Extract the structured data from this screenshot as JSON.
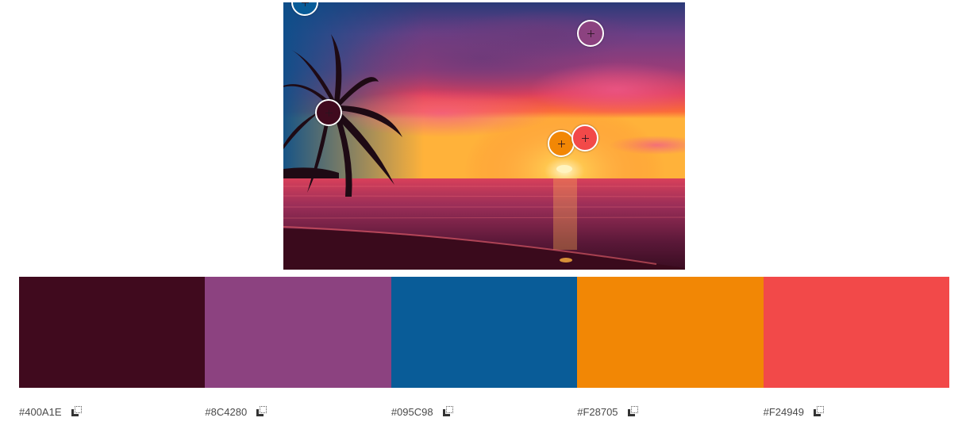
{
  "photo": {
    "description_icon": "sunset-palm-beach-photo"
  },
  "pickers": [
    {
      "color": "#095C98",
      "icon": "color-picker-target"
    },
    {
      "color": "#8C4280",
      "icon": "color-picker-target"
    },
    {
      "color": "#400A1E",
      "icon": "color-picker-target"
    },
    {
      "color": "#F28705",
      "icon": "color-picker-target"
    },
    {
      "color": "#F24949",
      "icon": "color-picker-target"
    }
  ],
  "palette": [
    {
      "hex": "#400A1E",
      "color": "#400A1E",
      "copy_icon": "copy-icon"
    },
    {
      "hex": "#8C4280",
      "color": "#8C4280",
      "copy_icon": "copy-icon"
    },
    {
      "hex": "#095C98",
      "color": "#095C98",
      "copy_icon": "copy-icon"
    },
    {
      "hex": "#F28705",
      "color": "#F28705",
      "copy_icon": "copy-icon"
    },
    {
      "hex": "#F24949",
      "color": "#F24949",
      "copy_icon": "copy-icon"
    }
  ]
}
